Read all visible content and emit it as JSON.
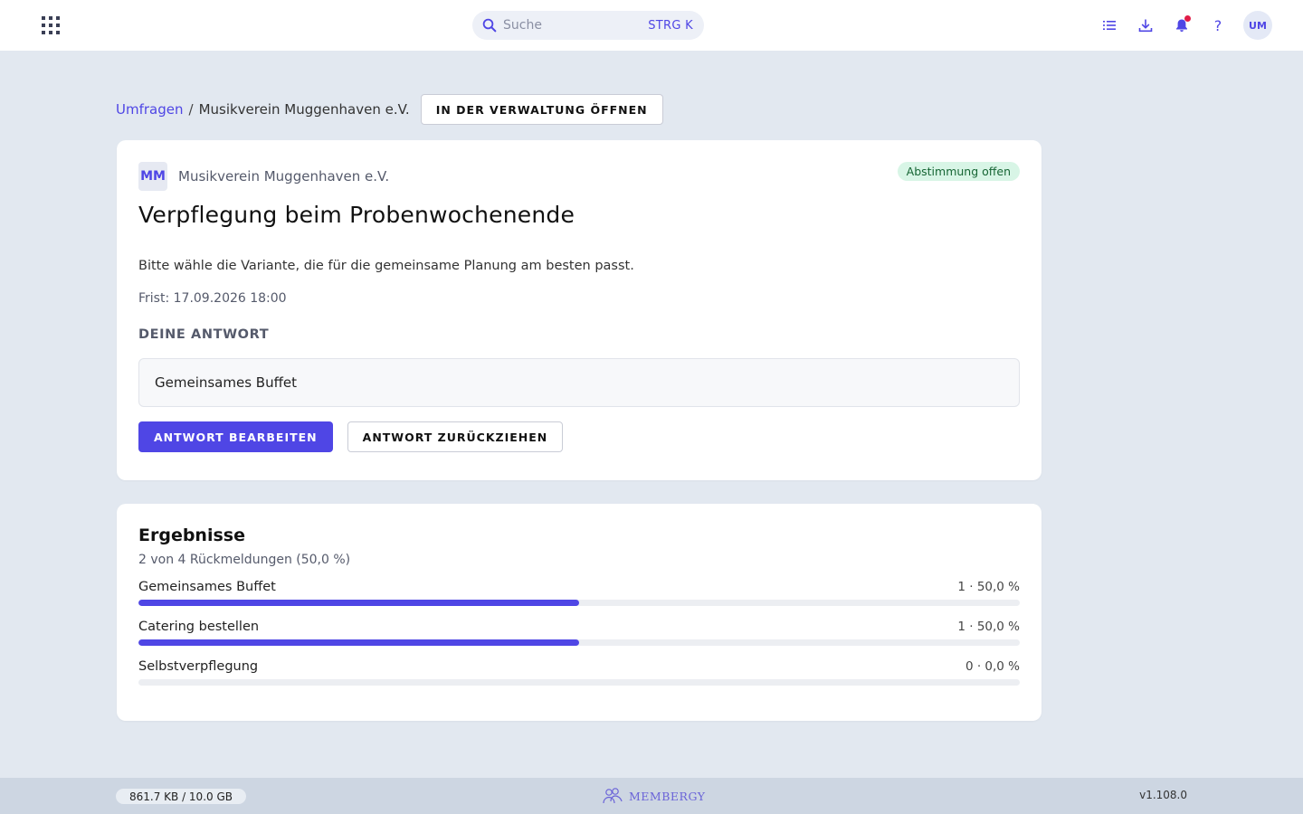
{
  "topbar": {
    "search_placeholder": "Suche",
    "search_shortcut": "STRG K",
    "avatar_initials": "UM"
  },
  "breadcrumb": {
    "parent": "Umfragen",
    "separator": "/",
    "current": "Musikverein Muggenhaven e.V.",
    "admin_button": "IN DER VERWALTUNG ÖFFNEN"
  },
  "poll": {
    "org_initials": "MM",
    "org_name": "Musikverein Muggenhaven e.V.",
    "status": "Abstimmung offen",
    "title": "Verpflegung beim Probenwochenende",
    "description": "Bitte wähle die Variante, die für die gemeinsame Planung am besten passt.",
    "deadline": "Frist: 17.09.2026 18:00",
    "answer_label": "DEINE ANTWORT",
    "answer_value": "Gemeinsames Buffet",
    "edit_button": "ANTWORT BEARBEITEN",
    "withdraw_button": "ANTWORT ZURÜCKZIEHEN"
  },
  "results": {
    "title": "Ergebnisse",
    "summary": "2 von 4 Rückmeldungen (50,0 %)",
    "items": [
      {
        "label": "Gemeinsames Buffet",
        "value": "1 · 50,0 %",
        "fraction": 0.5
      },
      {
        "label": "Catering bestellen",
        "value": "1 · 50,0 %",
        "fraction": 0.5
      },
      {
        "label": "Selbstverpflegung",
        "value": "0 · 0,0 %",
        "fraction": 0
      }
    ]
  },
  "footer": {
    "storage": "861.7 KB / 10.0 GB",
    "brand": "MEMBERGY",
    "version": "v1.108.0"
  },
  "colors": {
    "accent": "#4f46e5",
    "background": "#e2e8f0",
    "status_bg": "#d8f5e6",
    "status_text": "#166534",
    "notification_dot": "#e11d48"
  },
  "icons": [
    "apps-grid-icon",
    "search-icon",
    "list-icon",
    "download-icon",
    "bell-icon",
    "help-icon",
    "membergy-logo-icon"
  ]
}
